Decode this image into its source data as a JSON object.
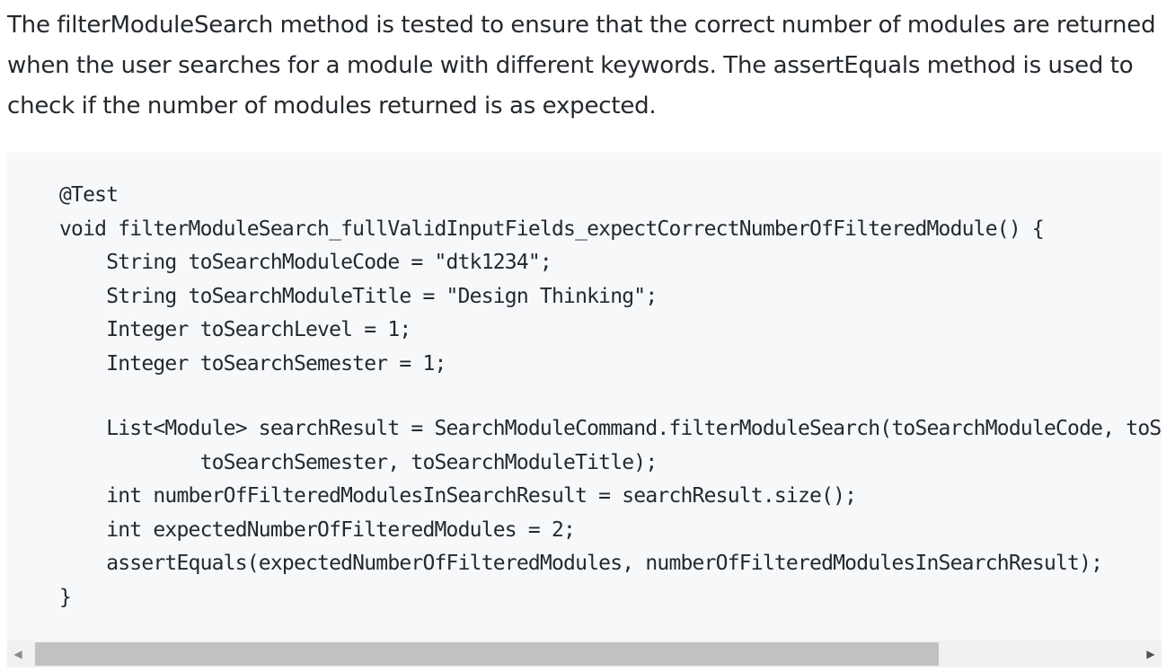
{
  "article": {
    "paragraph": "The filterModuleSearch method is tested to ensure that the correct number of modules are returned when the user searches for a module with different keywords. The assertEquals method is used to check if the number of modules returned is as expected."
  },
  "code": {
    "lines": [
      "@Test",
      "void filterModuleSearch_fullValidInputFields_expectCorrectNumberOfFilteredModule() {",
      "    String toSearchModuleCode = \"dtk1234\";",
      "    String toSearchModuleTitle = \"Design Thinking\";",
      "    Integer toSearchLevel = 1;",
      "    Integer toSearchSemester = 1;",
      "",
      "    List<Module> searchResult = SearchModuleCommand.filterModuleSearch(toSearchModuleCode, toSearchLevel,",
      "            toSearchSemester, toSearchModuleTitle);",
      "    int numberOfFilteredModulesInSearchResult = searchResult.size();",
      "    int expectedNumberOfFilteredModules = 2;",
      "    assertEquals(expectedNumberOfFilteredModules, numberOfFilteredModulesInSearchResult);",
      "}"
    ]
  },
  "scrollbar": {
    "left_arrow": "◀",
    "right_arrow": "▶"
  }
}
